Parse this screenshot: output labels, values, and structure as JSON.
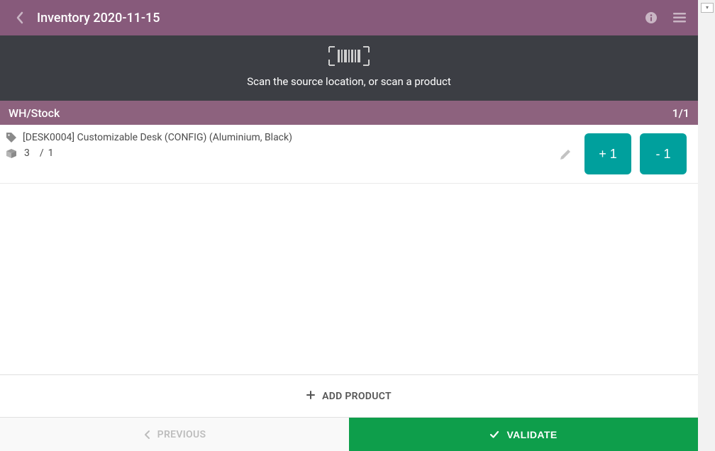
{
  "header": {
    "title": "Inventory 2020-11-15"
  },
  "scan": {
    "hint": "Scan the source location, or scan a product"
  },
  "location": {
    "name": "WH/Stock",
    "pager": "1/1"
  },
  "product": {
    "name": "[DESK0004] Customizable Desk (CONFIG) (Aluminium, Black)",
    "qty_counted": "3",
    "qty_separator": "/",
    "qty_expected": "1",
    "plus_label": "+ 1",
    "minus_label": "- 1"
  },
  "actions": {
    "add_product": "ADD PRODUCT",
    "previous": "PREVIOUS",
    "validate": "VALIDATE"
  },
  "colors": {
    "brand": "#875a7b",
    "teal": "#00a09d",
    "green": "#0e9e4b"
  }
}
